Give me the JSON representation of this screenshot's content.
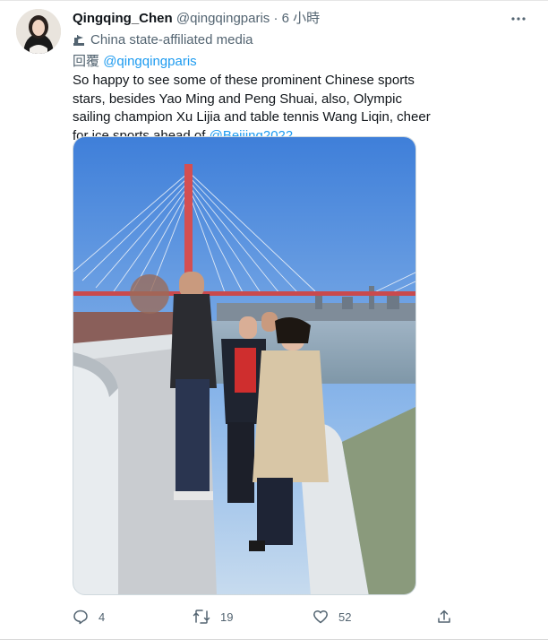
{
  "author": {
    "display_name": "Qingqing_Chen",
    "handle": "@qingqingparis",
    "separator": "·",
    "time": "6 小時",
    "affiliation_label": "China state-affiliated media"
  },
  "reply": {
    "prefix": "回覆",
    "mention": "@qingqingparis"
  },
  "tweet": {
    "text": "So happy to see some of these prominent Chinese sports stars, besides Yao Ming and Peng Shuai, also, Olympic sailing champion Xu Lijia and table tennis Wang Liqin, cheer for ice sports ahead of ",
    "hashtag_mention": "@Beijing2022"
  },
  "actions": {
    "replies": "4",
    "retweets": "19",
    "likes": "52"
  },
  "icons": {
    "more": "more-horizontal-icon",
    "affiliation": "flag-icon",
    "reply": "speech-bubble-icon",
    "retweet": "retweet-icon",
    "like": "heart-icon",
    "share": "share-icon"
  },
  "colors": {
    "link": "#1d9bf0",
    "secondary_text": "#536471",
    "primary_text": "#0f1419"
  }
}
